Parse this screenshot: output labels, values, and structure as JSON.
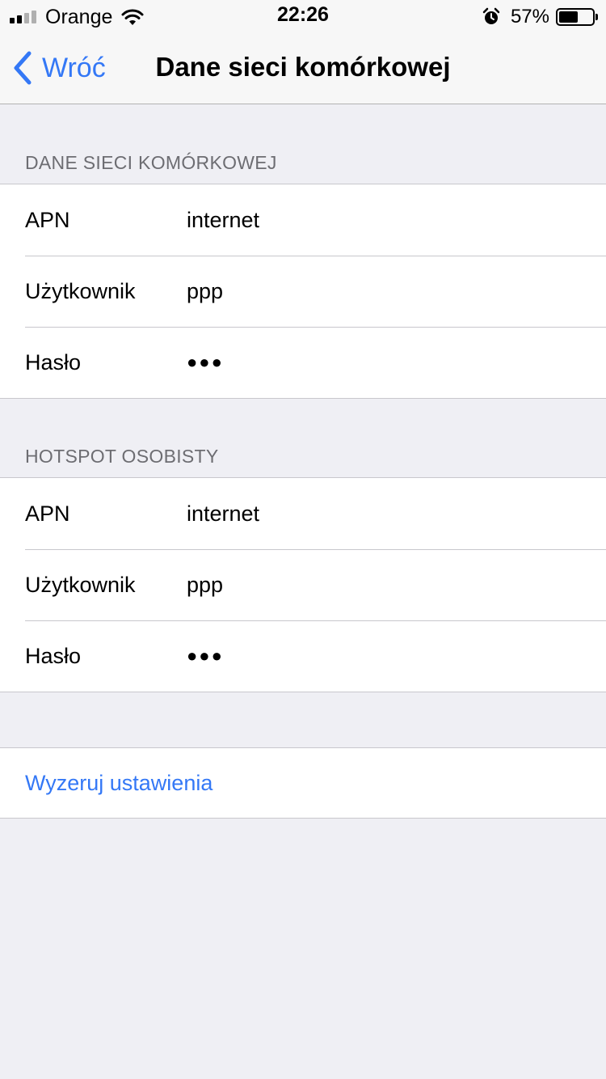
{
  "status_bar": {
    "carrier": "Orange",
    "time": "22:26",
    "battery_percent": "57%",
    "battery_level": 0.57,
    "signal_bars_active": 2,
    "signal_bars_total": 4
  },
  "nav": {
    "back_label": "Wróć",
    "title": "Dane sieci komórkowej"
  },
  "cellular_data": {
    "header": "DANE SIECI KOMÓRKOWEJ",
    "rows": [
      {
        "label": "APN",
        "value": "internet"
      },
      {
        "label": "Użytkownik",
        "value": "ppp"
      },
      {
        "label": "Hasło",
        "value": "●●●"
      }
    ]
  },
  "personal_hotspot": {
    "header": "HOTSPOT OSOBISTY",
    "rows": [
      {
        "label": "APN",
        "value": "internet"
      },
      {
        "label": "Użytkownik",
        "value": "ppp"
      },
      {
        "label": "Hasło",
        "value": "●●●"
      }
    ]
  },
  "reset": {
    "label": "Wyzeruj ustawienia"
  },
  "colors": {
    "accent": "#3478f6",
    "background": "#efeff4",
    "section_header": "#6d6d72"
  }
}
